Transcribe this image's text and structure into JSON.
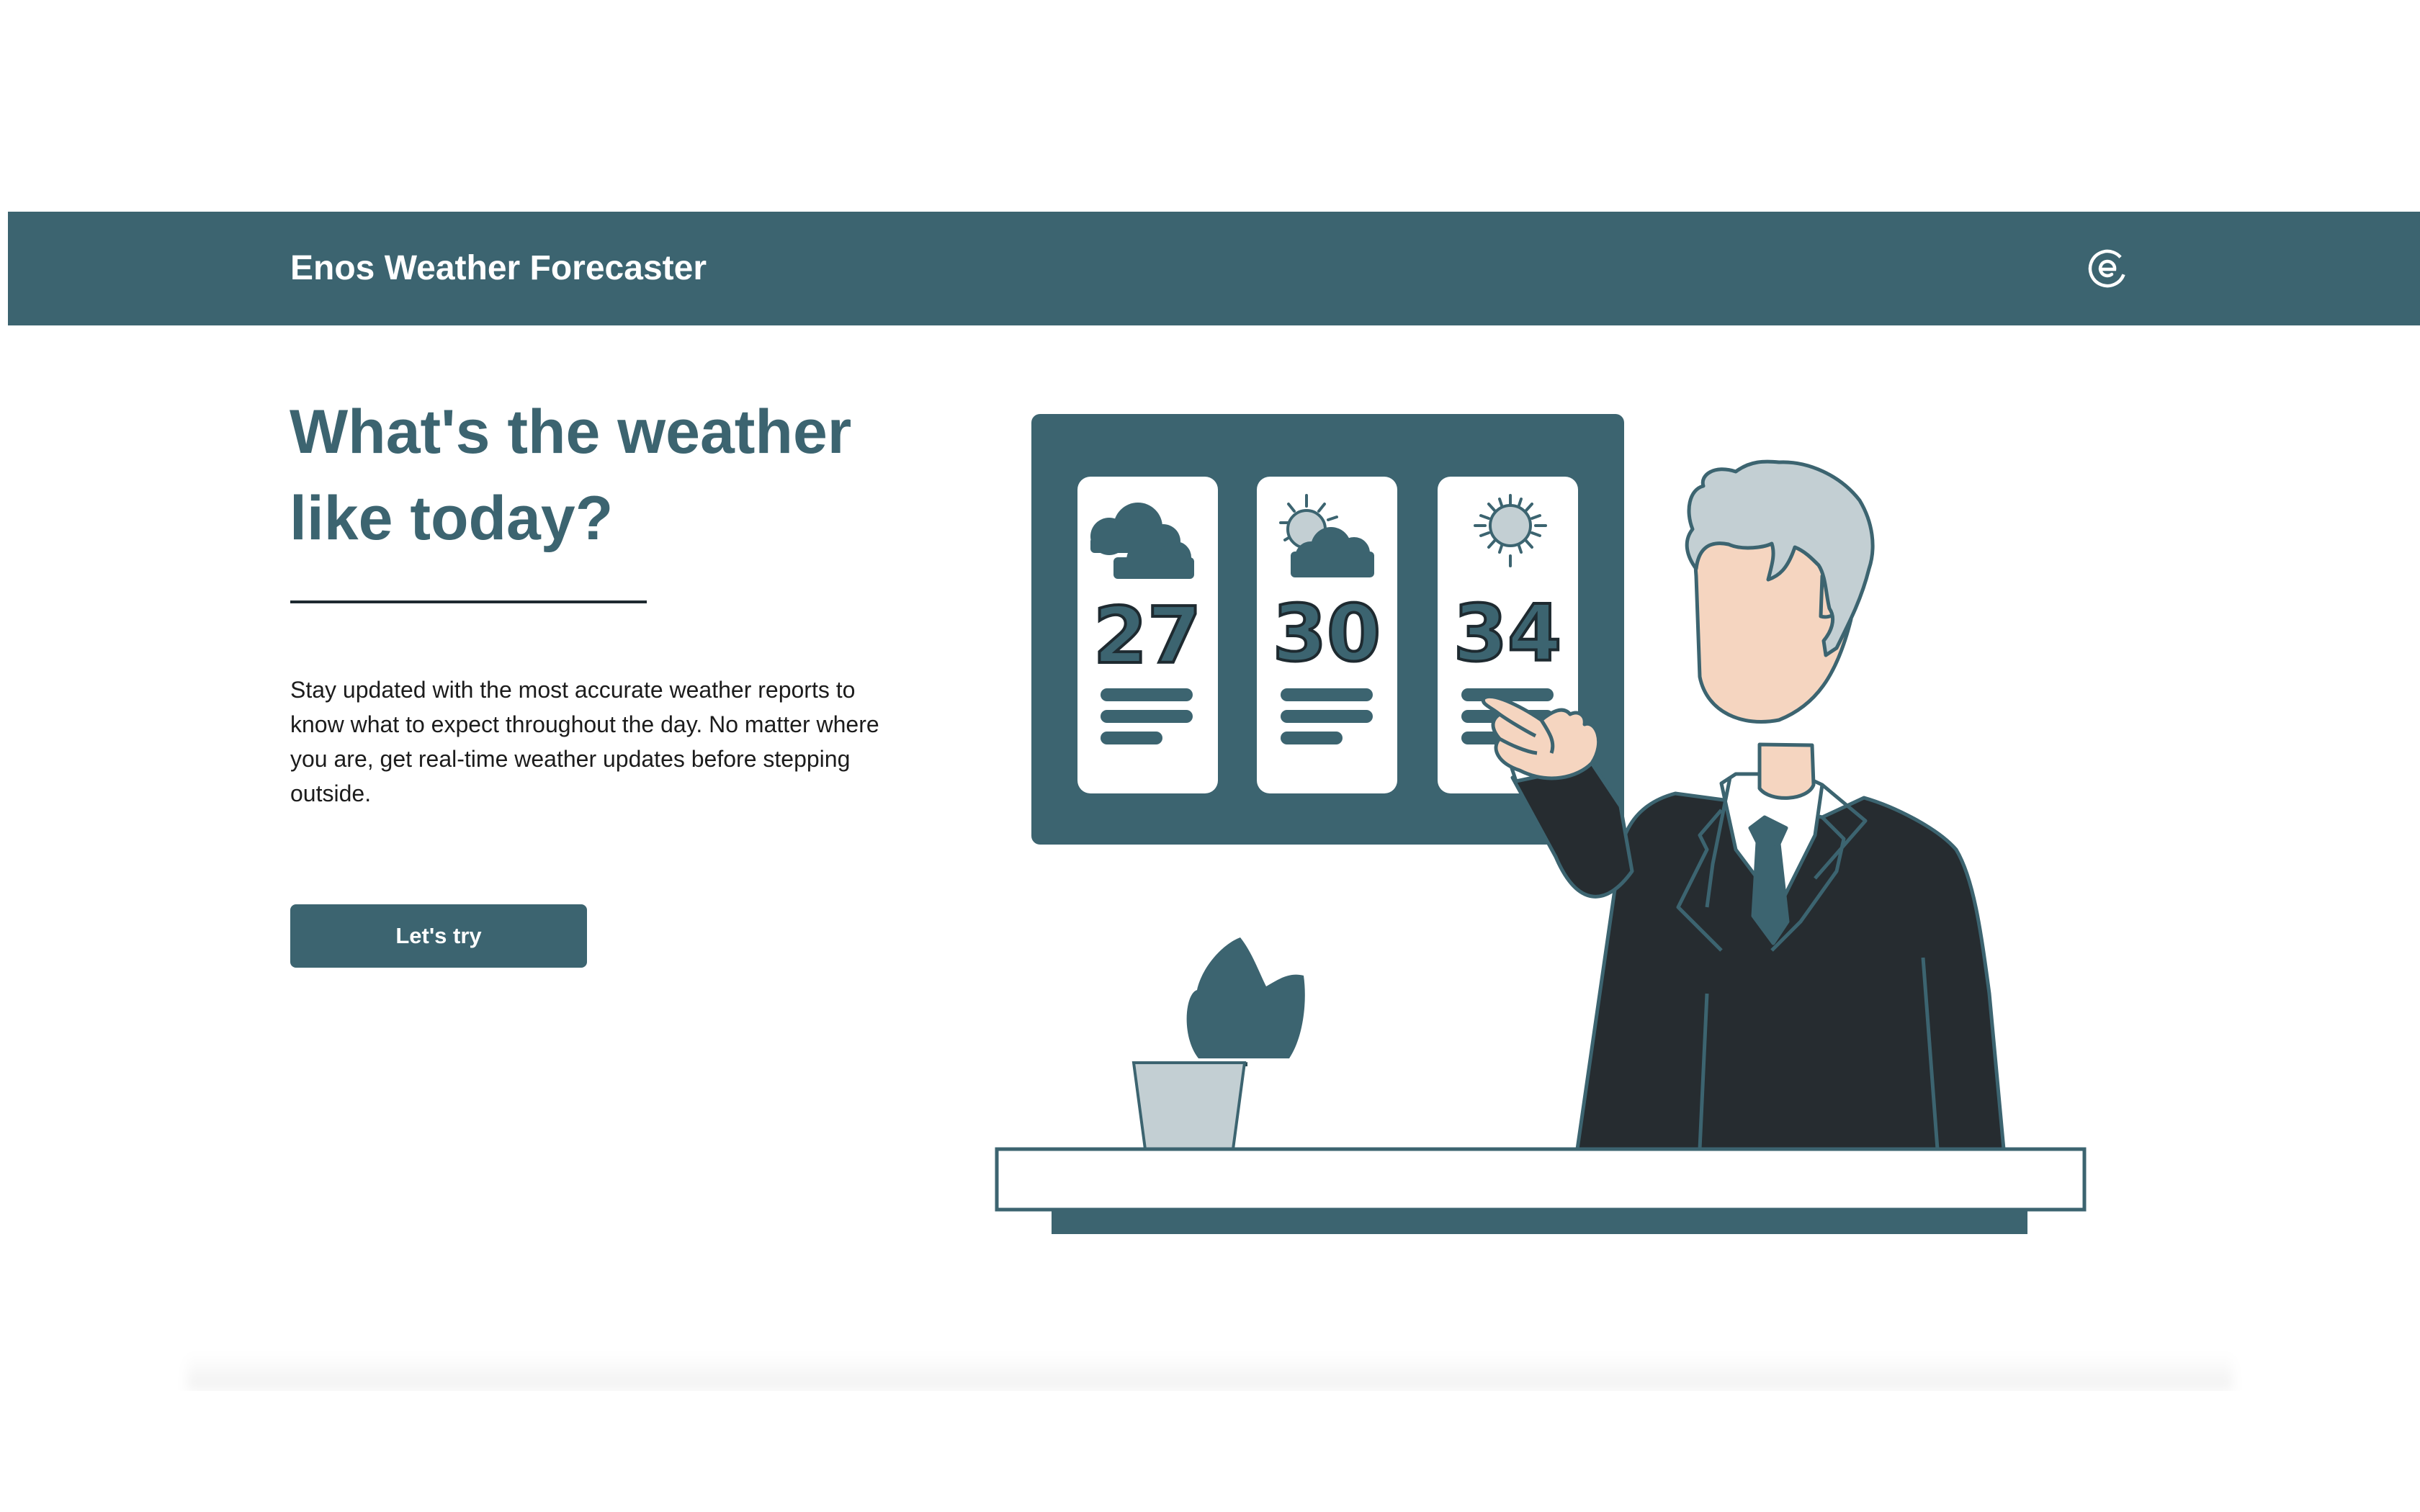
{
  "header": {
    "title": "Enos Weather Forecaster",
    "logo_icon": "enos-e-logo-icon",
    "bg_color": "#3c6470"
  },
  "hero": {
    "headline": "What's the weather like today?",
    "description": "Stay updated with the most accurate weather reports to know what to expect throughout the day. No matter where you are, get real-time weather updates before stepping outside.",
    "cta_label": "Let's try",
    "accent_color": "#3c6470"
  },
  "illustration": {
    "forecast_cards": [
      {
        "icon": "cloudy-icon",
        "temperature": "27"
      },
      {
        "icon": "partly-cloudy-icon",
        "temperature": "30"
      },
      {
        "icon": "sunny-icon",
        "temperature": "34"
      }
    ]
  }
}
